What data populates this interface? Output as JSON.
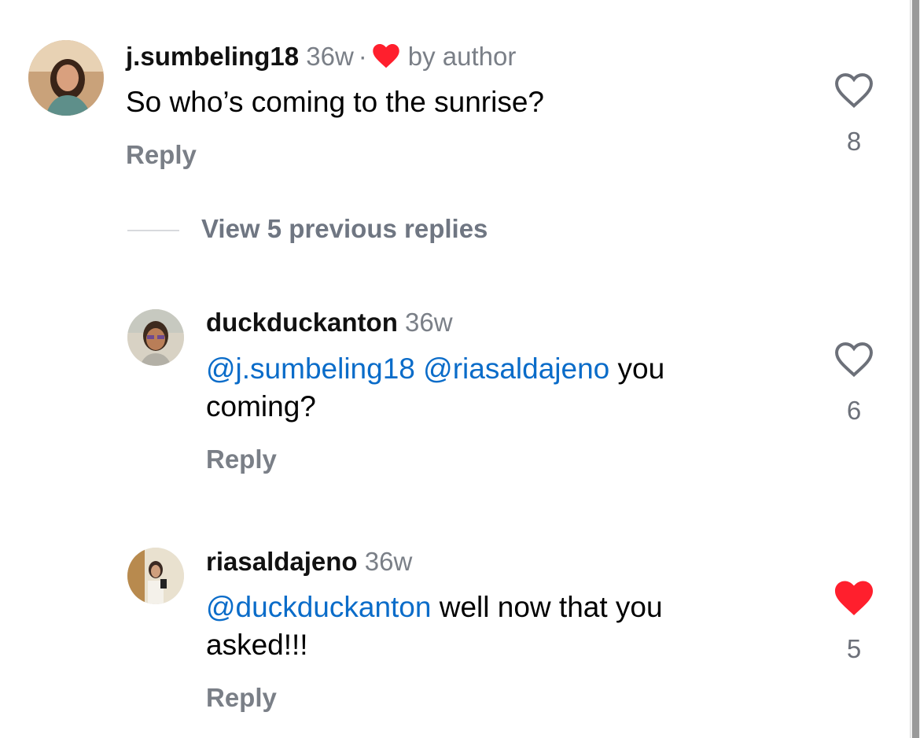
{
  "comments": [
    {
      "username": "j.sumbeling18",
      "time": "36w",
      "separator": "·",
      "liked_by_author_label": "by author",
      "text": "So who’s coming to the sunrise?",
      "reply_label": "Reply",
      "like_count": "8",
      "liked": false
    },
    {
      "username": "duckduckanton",
      "time": "36w",
      "mentions": [
        "@j.sumbeling18",
        "@riasaldajeno"
      ],
      "text_after": " you coming?",
      "reply_label": "Reply",
      "like_count": "6",
      "liked": false
    },
    {
      "username": "riasaldajeno",
      "time": "36w",
      "mentions": [
        "@duckduckanton"
      ],
      "text_after": " well now that you asked!!!",
      "reply_label": "Reply",
      "like_count": "5",
      "liked": true
    }
  ],
  "view_replies_label": "View 5 previous replies",
  "colors": {
    "mention": "#0a6cc9",
    "like_red": "#ff1f2d",
    "secondary_text": "#7a7f87"
  },
  "icons": {
    "like": "heart-outline-icon",
    "liked": "heart-filled-icon",
    "author_like": "heart-filled-icon"
  }
}
